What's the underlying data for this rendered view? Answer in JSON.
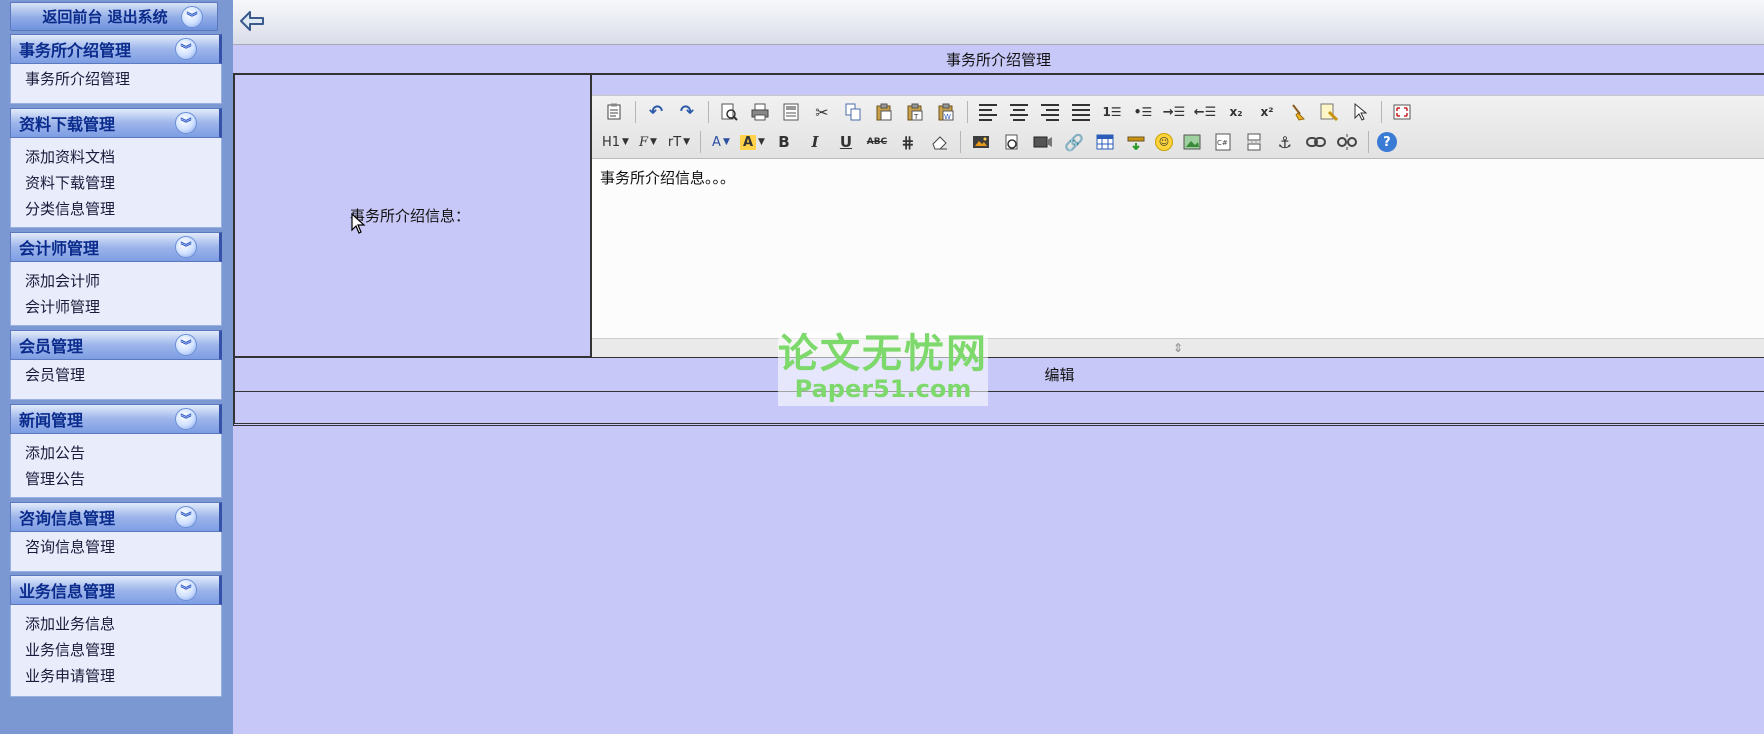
{
  "sidebar": {
    "top_button": "返回前台 退出系统",
    "sections": [
      {
        "title": "事务所介绍管理",
        "items": [
          "事务所介绍管理"
        ]
      },
      {
        "title": "资料下载管理",
        "items": [
          "添加资料文档",
          "资料下载管理",
          "分类信息管理"
        ]
      },
      {
        "title": "会计师管理",
        "items": [
          "添加会计师",
          "会计师管理"
        ]
      },
      {
        "title": "会员管理",
        "items": [
          "会员管理"
        ]
      },
      {
        "title": "新闻管理",
        "items": [
          "添加公告",
          "管理公告"
        ]
      },
      {
        "title": "咨询信息管理",
        "items": [
          "咨询信息管理"
        ]
      },
      {
        "title": "业务信息管理",
        "items": [
          "添加业务信息",
          "业务信息管理",
          "业务申请管理"
        ]
      }
    ],
    "section_icon": "collapse-chevron-icon"
  },
  "page": {
    "title": "事务所介绍管理",
    "field_label": "事务所介绍信息：",
    "editor_content": "事务所介绍信息。。。",
    "submit_label": "编辑"
  },
  "editor": {
    "heading_label": "H1",
    "font_label": "F",
    "size_label": "rT",
    "font_color_label": "A",
    "highlight_label": "A",
    "bold_label": "B",
    "italic_label": "I",
    "underline_label": "U",
    "strike_label": "ABC"
  },
  "watermark": {
    "line1": "论文无忧网",
    "line2": "Paper51.com"
  }
}
